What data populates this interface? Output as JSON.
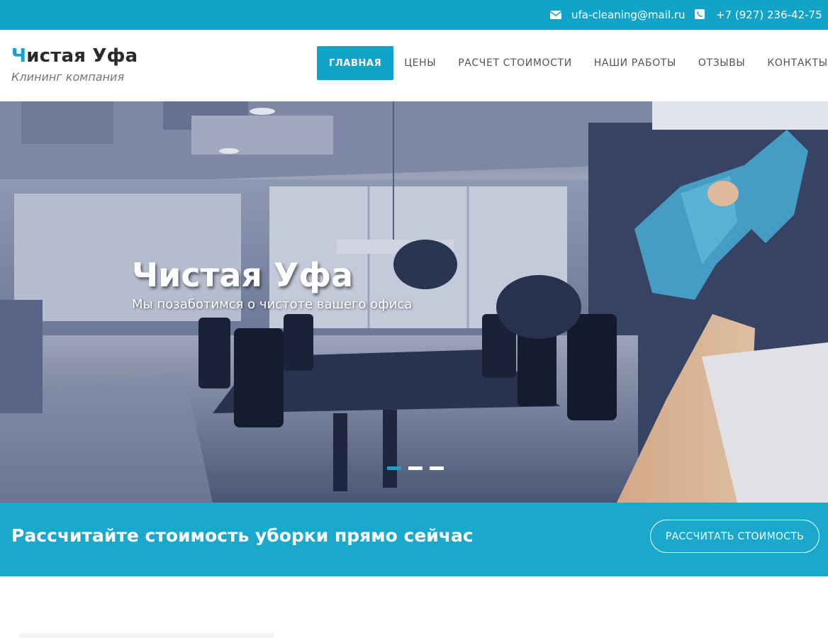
{
  "topbar": {
    "email": "ufa-cleaning@mail.ru",
    "phone": "+7 (927) 236-42-75",
    "email_icon": "envelope-icon",
    "phone_icon": "phone-icon"
  },
  "logo": {
    "first_letter": "Ч",
    "rest": "истая Уфа",
    "subtitle": "Клининг компания"
  },
  "nav": {
    "items": [
      {
        "label": "ГЛАВНАЯ",
        "active": true
      },
      {
        "label": "ЦЕНЫ"
      },
      {
        "label": "РАСЧЕТ СТОИМОСТИ"
      },
      {
        "label": "НАШИ РАБОТЫ"
      },
      {
        "label": "ОТЗЫВЫ"
      },
      {
        "label": "КОНТАКТЫ"
      }
    ]
  },
  "hero": {
    "title": "Чистая Уфа",
    "subtitle": "Мы позаботимся о чистоте вашего офиса",
    "slides_count": 3,
    "active_slide": 1
  },
  "cta": {
    "text": "Рассчитайте стоимость уборки прямо сейчас",
    "button": "РАССЧИТАТЬ СТОИМОСТЬ"
  },
  "colors": {
    "accent": "#11a3c8",
    "cta_band": "#1aa9cd"
  }
}
